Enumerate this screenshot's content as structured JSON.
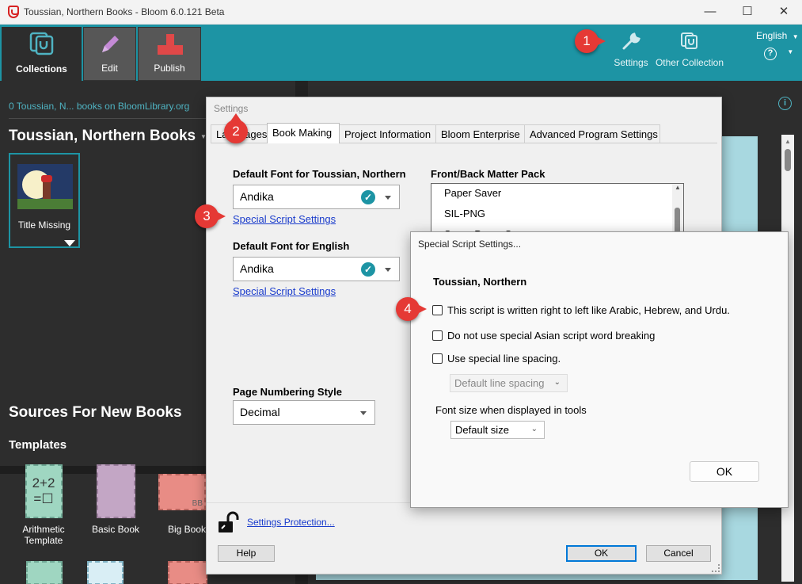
{
  "window": {
    "title": "Toussian, Northern Books - Bloom 6.0.121 Beta",
    "minimize": "—",
    "maximize": "☐",
    "close": "✕"
  },
  "toolbar": {
    "tabs": [
      {
        "label": "Collections",
        "icon": "collections-icon"
      },
      {
        "label": "Edit",
        "icon": "pencil-icon"
      },
      {
        "label": "Publish",
        "icon": "publish-icon"
      }
    ],
    "settings_label": "Settings",
    "other_collection_label": "Other Collection",
    "language": "English",
    "help_glyph": "?"
  },
  "collection": {
    "library_link": "0 Toussian, N... books on BloomLibrary.org",
    "title": "Toussian, Northern Books",
    "books": [
      {
        "title": "Title Missing"
      }
    ]
  },
  "sources": {
    "title": "Sources For New Books",
    "templates_heading": "Templates",
    "templates": [
      {
        "label": "Arithmetic Template",
        "glyph": "2+2\n=☐"
      },
      {
        "label": "Basic Book"
      },
      {
        "label": "Big Book",
        "glyph": "BB"
      }
    ]
  },
  "settings_dialog": {
    "title": "Settings",
    "tabs": [
      "Languages",
      "Book Making",
      "Project Information",
      "Bloom Enterprise",
      "Advanced Program Settings"
    ],
    "active_tab": "Book Making",
    "default_font_label_vernacular": "Default Font for Toussian, Northern",
    "default_font_vernacular": "Andika",
    "special_script_link_1": "Special Script Settings",
    "default_font_label_english": "Default Font for English",
    "default_font_english": "Andika",
    "special_script_link_2": "Special Script Settings",
    "page_numbering_label": "Page Numbering Style",
    "page_numbering_value": "Decimal",
    "front_back_label": "Front/Back Matter Pack",
    "front_back_items": [
      "Paper Saver",
      "SIL-PNG",
      "Super Paper Saver"
    ],
    "settings_protection_link": "Settings Protection...",
    "help_button": "Help",
    "ok_button": "OK",
    "cancel_button": "Cancel"
  },
  "special_script_dialog": {
    "title": "Special Script Settings...",
    "language_name": "Toussian, Northern",
    "options": [
      {
        "label": "This script is written right to left like Arabic, Hebrew, and Urdu.",
        "checked": false
      },
      {
        "label": "Do not use special Asian script word breaking",
        "checked": false
      },
      {
        "label": "Use special line spacing.",
        "checked": false
      }
    ],
    "line_spacing_value": "Default line spacing",
    "font_size_label": "Font size when displayed in tools",
    "font_size_value": "Default size",
    "ok_button": "OK"
  },
  "callouts": [
    "1",
    "2",
    "3",
    "4"
  ],
  "colors": {
    "teal": "#1d94a4",
    "dark_panel": "#2d2d2d",
    "callout_red": "#e53935",
    "link_blue": "#1a3ccc"
  }
}
